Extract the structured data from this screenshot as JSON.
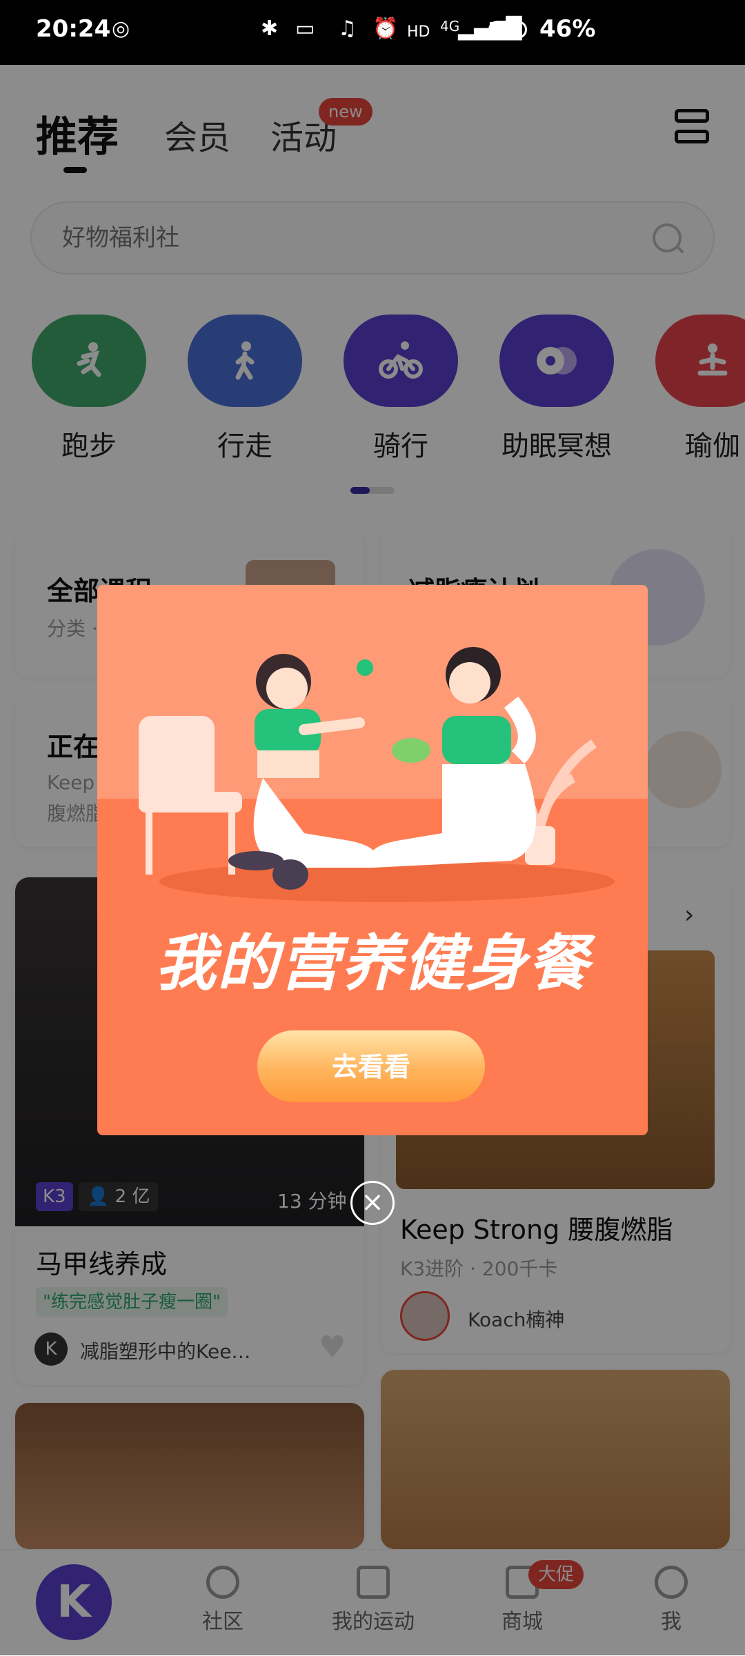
{
  "status_bar": {
    "time": "20:24",
    "network": "4G",
    "battery_percent": "46%"
  },
  "header": {
    "tabs": [
      {
        "label": "推荐",
        "active": true
      },
      {
        "label": "会员",
        "active": false
      },
      {
        "label": "活动",
        "active": false,
        "badge": "new"
      }
    ],
    "menu_icon": "layout-menu-icon"
  },
  "search": {
    "placeholder": "好物福利社",
    "icon": "search-icon"
  },
  "categories": [
    {
      "label": "跑步",
      "color": "#3fa86b",
      "icon": "running-icon"
    },
    {
      "label": "行走",
      "color": "#4a6fd6",
      "icon": "walking-icon"
    },
    {
      "label": "骑行",
      "color": "#5b3fcf",
      "icon": "cycling-icon"
    },
    {
      "label": "助眠冥想",
      "color": "#5b3fcf",
      "icon": "meditation-icon"
    },
    {
      "label": "瑜伽",
      "color": "#e8444c",
      "icon": "yoga-icon"
    }
  ],
  "cards": {
    "all_courses": {
      "title": "全部课程",
      "subtitle": "分类 ·"
    },
    "fat_loss_plan": {
      "title": "减脂瘦计划"
    },
    "in_progress": {
      "title": "正在",
      "line1": "Keep",
      "line2": "腹燃脂"
    }
  },
  "courses": [
    {
      "level": "K3",
      "viewers": "2 亿",
      "duration": "13 分钟",
      "title": "马甲线养成",
      "quote": "\"练完感觉肚子瘦一圈\"",
      "author": "减脂塑形中的Kee…"
    },
    {
      "title": "Keep Strong 腰腹燃脂",
      "meta": "K3进阶 · 200千卡",
      "author": "Koach楠神"
    }
  ],
  "bottom_nav": {
    "items": [
      {
        "label": "社区",
        "icon": "community-icon"
      },
      {
        "label": "我的运动",
        "icon": "activity-icon"
      },
      {
        "label": "商城",
        "icon": "shop-icon",
        "badge": "大促"
      },
      {
        "label": "我",
        "icon": "profile-icon"
      }
    ],
    "home_logo": "K"
  },
  "modal": {
    "headline": "我的营养健身餐",
    "cta_label": "去看看",
    "close_icon": "close-icon"
  }
}
